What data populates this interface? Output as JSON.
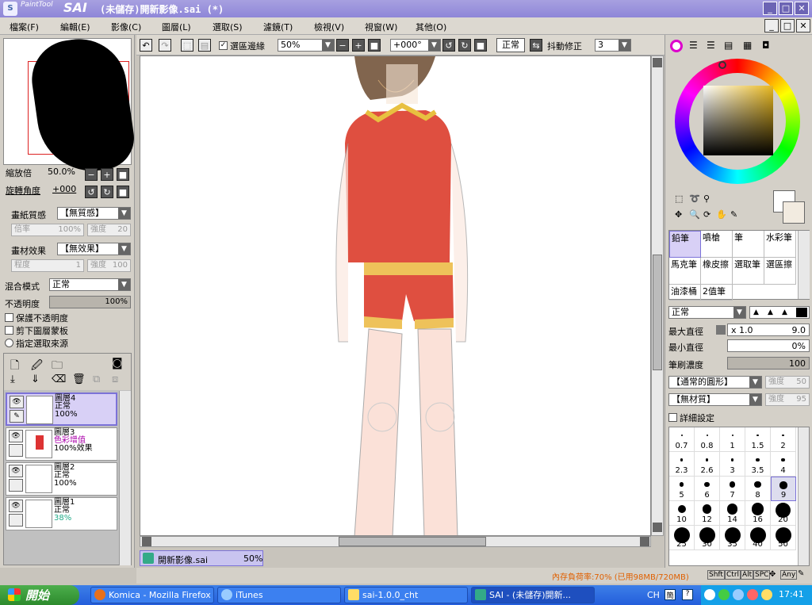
{
  "title": {
    "brand_small": "PaintTool",
    "brand": "SAI",
    "document": "(未儲存)開新影像.sai (*)"
  },
  "menu": [
    "檔案(F)",
    "編輯(E)",
    "影像(C)",
    "圖層(L)",
    "選取(S)",
    "濾鏡(T)",
    "檢視(V)",
    "視窗(W)",
    "其他(O)"
  ],
  "toolbar": {
    "selection_edge_label": "選區邊緣",
    "zoom": "50%",
    "angle": "+000°",
    "blend": "正常",
    "stabilizer_label": "抖動修正",
    "stabilizer": "3"
  },
  "navigator": {
    "zoom_label": "縮放倍",
    "zoom_value": "50.0%",
    "rotate_label": "旋轉角度",
    "rotate_value": "+000"
  },
  "paper": {
    "texture_label": "畫紙質感",
    "texture": "【無質感】",
    "scale_label": "倍率",
    "scale": "100%",
    "strength_label": "強度",
    "strength": "20"
  },
  "effect": {
    "label": "畫材效果",
    "value": "【無效果】",
    "degree_label": "程度",
    "degree": "1",
    "strength_label": "強度",
    "strength": "100"
  },
  "blend": {
    "mode_label": "混合模式",
    "mode": "正常",
    "opacity_label": "不透明度",
    "opacity": "100%",
    "opacity_fill": 1.0
  },
  "layer_opts": [
    "保護不透明度",
    "剪下圖層蒙板",
    "指定選取來源"
  ],
  "layers": [
    {
      "name": "圖層4",
      "mode": "正常",
      "opacity": "100%",
      "extra": ""
    },
    {
      "name": "圖層3",
      "mode": "色彩增值",
      "opacity": "100%效果",
      "extra": ""
    },
    {
      "name": "圖層2",
      "mode": "正常",
      "opacity": "100%",
      "extra": ""
    },
    {
      "name": "圖層1",
      "mode": "正常",
      "opacity": "38%",
      "extra": ""
    }
  ],
  "doc_tab": {
    "name": "開新影像.sai",
    "zoom": "50%"
  },
  "brushes": [
    [
      "鉛筆",
      "噴槍",
      "筆",
      "水彩筆"
    ],
    [
      "馬克筆",
      "橡皮擦",
      "選取筆",
      "選區擦"
    ],
    [
      "油漆桶",
      "2值筆",
      "",
      ""
    ]
  ],
  "brush_settings": {
    "blend": "正常",
    "max_size_label": "最大直徑",
    "max_size_mult": "x 1.0",
    "max_size": "9.0",
    "min_size_label": "最小直徑",
    "min_size": "0%",
    "density_label": "筆刷濃度",
    "density": "100",
    "shape": "【通常的圓形】",
    "shape_strength_label": "強度",
    "shape_strength": "50",
    "texture": "【無材質】",
    "texture_strength_label": "強度",
    "texture_strength": "95",
    "detail_label": "詳細設定"
  },
  "sizes": [
    "0.7",
    "0.8",
    "1",
    "1.5",
    "2",
    "2.3",
    "2.6",
    "3",
    "3.5",
    "4",
    "5",
    "6",
    "7",
    "8",
    "9",
    "10",
    "12",
    "14",
    "16",
    "20",
    "25",
    "30",
    "35",
    "40",
    "50"
  ],
  "status": {
    "memory": "內存負荷率:70% (已用98MB/720MB)",
    "keys": [
      "Shft",
      "Ctrl",
      "Alt",
      "SPC",
      "Any"
    ]
  },
  "taskbar": {
    "start": "開始",
    "tasks": [
      "Komica - Mozilla Firefox",
      "iTunes",
      "sai-1.0.0_cht",
      "SAI - (未儲存)開新..."
    ],
    "lang": "CH",
    "time": "17:41"
  },
  "colors": {
    "title": "#8e86d8",
    "selection": "#d8d0f6",
    "taskbar": "#245edb"
  }
}
